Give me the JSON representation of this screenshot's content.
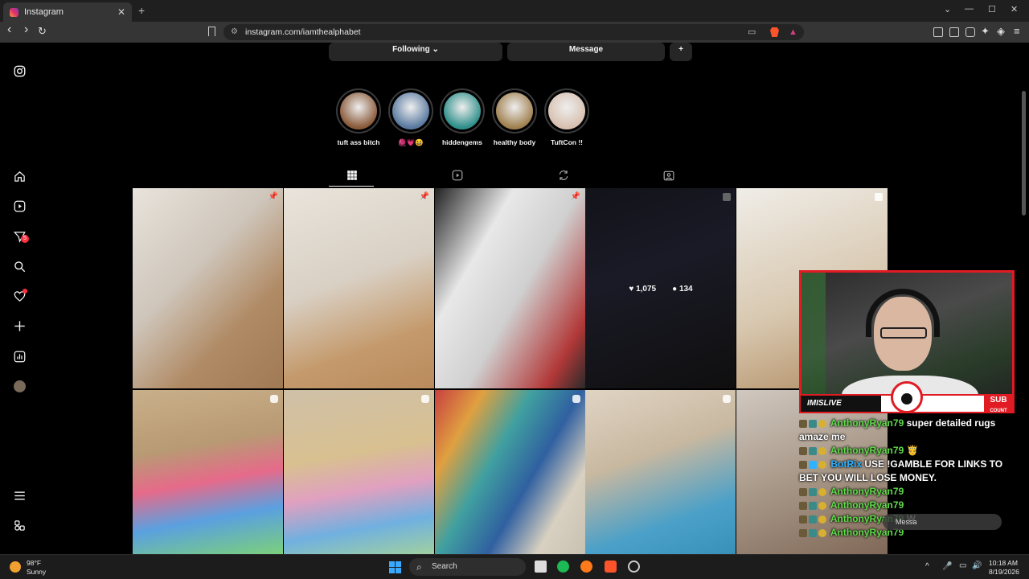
{
  "browser": {
    "tab_title": "Instagram",
    "url": "instagram.com/iamthealphabet",
    "glyphs": {
      "tab_close": "✕",
      "new_tab": "+",
      "back": "‹",
      "forward": "›",
      "reload": "↻",
      "minimize": "—",
      "maximize": "☐",
      "close": "✕",
      "collapse": "⌄"
    }
  },
  "profile": {
    "following_label": "Following",
    "following_caret": "⌄",
    "message_label": "Message",
    "add_user_glyph": "+"
  },
  "sidebar": {
    "messages_badge": "5"
  },
  "stories": [
    {
      "label": "tuft ass bitch",
      "color": "#8a5a3a"
    },
    {
      "label": "🧶💗😆",
      "color": "#5a7aa0"
    },
    {
      "label": "hiddengems",
      "color": "#2f8f8a"
    },
    {
      "label": "healthy body",
      "color": "#a08050"
    },
    {
      "label": "TuftCon !!",
      "color": "#d8c0b0"
    }
  ],
  "posts": [
    {
      "name": "post-majora-mask-rug",
      "bg": "linear-gradient(135deg,#e8e3dc 0%,#cfc6bb 40%,#b08a64 70%,#a07a55 100%)",
      "marker": "pin"
    },
    {
      "name": "post-yoga-rug",
      "bg": "linear-gradient(160deg,#e9e4dc 0%,#d9d0c4 45%,#c49a6c 75%,#b98a5c 100%)",
      "marker": "pin"
    },
    {
      "name": "post-graffiti-wall",
      "bg": "linear-gradient(120deg,#222 0%,#e8e8e8 30%,#d0d0d0 55%,#b23838 85%,#2a2a2a 100%)",
      "marker": "pin"
    },
    {
      "name": "post-gta-poster",
      "bg": "linear-gradient(160deg,#2a2a3a 0%,#3b3a55 40%,#222 100%)",
      "marker": "multi"
    },
    {
      "name": "post-round-rug",
      "bg": "linear-gradient(160deg,#f0ede8 0%,#d8c8b0 55%,#b08a60 100%)",
      "marker": "multi"
    },
    {
      "name": "post-rainbow-rug-1",
      "bg": "linear-gradient(170deg,#c9b08a 0%,#b89a74 35%,#e66a8a 55%,#5aa0e0 75%,#7bd07b 100%)",
      "marker": "reel"
    },
    {
      "name": "post-rainbow-rug-2",
      "bg": "linear-gradient(170deg,#cfc0a8 0%,#d8c090 40%,#e0a0c0 60%,#70b0e0 80%,#a0d0a0 100%)",
      "marker": "reel"
    },
    {
      "name": "post-tile-wall",
      "bg": "linear-gradient(120deg,#c84040 0%,#e0a040 20%,#40a0a0 40%,#3060a0 60%,#d8d0c0 80%,#c8c0b0 100%)",
      "marker": "reel"
    },
    {
      "name": "post-smiling-woman",
      "bg": "linear-gradient(160deg,#e0d4c4 0%,#c8b8a0 40%,#4aa0c8 75%,#3890b8 100%)",
      "marker": "reel"
    },
    {
      "name": "post-studio-shelves",
      "bg": "linear-gradient(160deg,#d0c8c0 0%,#a89888 50%,#806858 100%)",
      "marker": "reel"
    }
  ],
  "hover_stats": {
    "likes": "1,075",
    "comments": "134",
    "like_glyph": "♥",
    "comment_glyph": "●"
  },
  "stream": {
    "streamer_label": "IMISLIVE",
    "sub_label": "SUB",
    "sub_sublabel": "COUNT",
    "message_preview": "Messa",
    "chat": [
      {
        "user": "AnthonyRyan79",
        "text": " super detailed rugs",
        "color": "#5fdc4a"
      },
      {
        "user": "",
        "text": "amaze me",
        "color": "#5fdc4a"
      },
      {
        "user": "AnthonyRyan79",
        "text": " 🤴",
        "color": "#5fdc4a"
      },
      {
        "user": "BotRix",
        "text": " USE !GAMBLE FOR LINKS TO",
        "color": "#2fb2ff"
      },
      {
        "user": "",
        "text": "BET YOU WILL LOSE MONEY.",
        "color": "#2fb2ff"
      },
      {
        "user": "AnthonyRyan79",
        "text": "",
        "color": "#5fdc4a"
      },
      {
        "user": "AnthonyRyan79",
        "text": "",
        "color": "#5fdc4a"
      },
      {
        "user": "AnthonyRyan79",
        "text": " W",
        "color": "#5fdc4a"
      },
      {
        "user": "AnthonyRyan79",
        "text": "",
        "color": "#5fdc4a"
      }
    ]
  },
  "taskbar": {
    "weather_temp": "98°F",
    "weather_desc": "Sunny",
    "search_placeholder": "Search",
    "search_glyph": "⌕",
    "tray_caret": "^",
    "time": "10:18 AM",
    "date": "8/19/2026"
  }
}
